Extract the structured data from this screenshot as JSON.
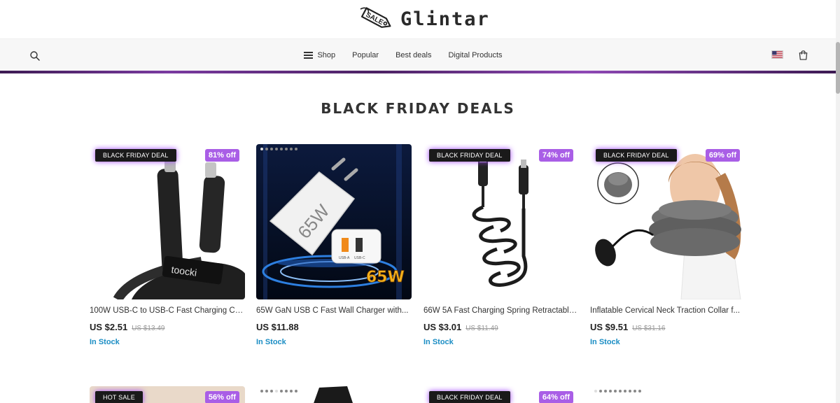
{
  "brand": {
    "name": "Glintar",
    "tag_text": "SALE"
  },
  "nav": {
    "items": [
      {
        "label": "Shop"
      },
      {
        "label": "Popular"
      },
      {
        "label": "Best deals"
      },
      {
        "label": "Digital Products"
      }
    ]
  },
  "icons": {
    "search": "search-icon",
    "menu": "hamburger-icon",
    "flag": "us-flag-icon",
    "cart": "shopping-bag-icon"
  },
  "colors": {
    "accent_purple": "#a95ee6",
    "stock_blue": "#1a8dc4",
    "badge_black": "#1a1a1a",
    "glow": "#a347ff"
  },
  "section": {
    "title": "BLACK FRIDAY DEALS"
  },
  "products": [
    {
      "title": "100W USB-C to USB-C Fast Charging Cabl...",
      "price": "US $2.51",
      "old_price": "US $13.49",
      "stock": "In Stock",
      "badge": "BLACK FRIDAY DEAL",
      "discount": "81% off",
      "image": "braided usb-c cable"
    },
    {
      "title": "65W GaN USB C Fast Wall Charger with...",
      "price": "US $11.88",
      "old_price": "",
      "stock": "In Stock",
      "badge": "",
      "discount": "",
      "image_text_a": "65W",
      "image_text_b": "65W",
      "port_a": "USB-A",
      "port_c": "USB-C"
    },
    {
      "title": "66W 5A Fast Charging Spring Retractable...",
      "price": "US $3.01",
      "old_price": "US $11.49",
      "stock": "In Stock",
      "badge": "BLACK FRIDAY DEAL",
      "discount": "74% off",
      "image": "coiled charging cable"
    },
    {
      "title": "Inflatable Cervical Neck Traction Collar f...",
      "price": "US $9.51",
      "old_price": "US $31.16",
      "stock": "In Stock",
      "badge": "BLACK FRIDAY DEAL",
      "discount": "69% off",
      "image": "neck traction collar"
    }
  ],
  "row2": [
    {
      "badge": "HOT SALE",
      "discount": "56% off"
    },
    {
      "badge": "",
      "discount": ""
    },
    {
      "badge": "BLACK FRIDAY DEAL",
      "discount": "64% off"
    },
    {
      "badge": "",
      "discount": ""
    }
  ]
}
